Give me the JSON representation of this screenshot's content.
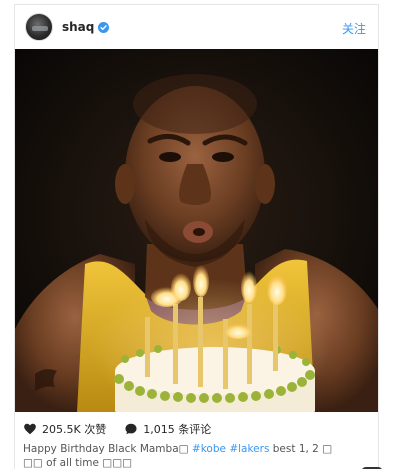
{
  "post": {
    "username": "shaq",
    "follow_label": "关注",
    "likes": "205.5K 次赞",
    "comments": "1,015 条评论",
    "caption_text": "Happy Birthday Black Mamba□",
    "caption_tags": [
      "#kobe",
      "#lakers"
    ],
    "caption_rest": "best 1, 2 □",
    "caption_line2": "□□ of all time □□□"
  },
  "icons": {
    "verified": "verified-badge-icon",
    "like": "heart-icon",
    "comment": "comment-bubble-icon",
    "save": "instagram-icon"
  },
  "colors": {
    "accent": "#3897f0",
    "text": "#262626",
    "jersey": "#e8b923",
    "skin": "#6b3e22"
  }
}
